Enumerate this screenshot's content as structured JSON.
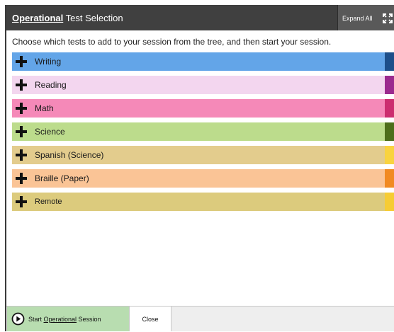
{
  "dialog": {
    "title_emphasis": "Operational",
    "title_rest": " Test Selection",
    "expand_all_label": "Expand All",
    "instructions": "Choose which tests to add to your session from the tree, and then start your session."
  },
  "tests": [
    {
      "label": "Writing",
      "bg": "#63a5e8",
      "stripe": "#1d4f8a"
    },
    {
      "label": "Reading",
      "bg": "#f3d6ef",
      "stripe": "#9b2a8e"
    },
    {
      "label": "Math",
      "bg": "#f589b8",
      "stripe": "#cc2e6f"
    },
    {
      "label": "Science",
      "bg": "#bcdc8c",
      "stripe": "#4d6e1b"
    },
    {
      "label": "Spanish (Science)",
      "bg": "#e3cc8d",
      "stripe": "#f9d33f"
    },
    {
      "label": "Braille (Paper)",
      "bg": "#fac496",
      "stripe": "#f18a22"
    },
    {
      "label": "Remote",
      "bg": "#dccb7d",
      "stripe": "#f6cc34"
    }
  ],
  "footer": {
    "start_prefix": "Start ",
    "start_emphasis": "Operational",
    "start_suffix": " Session",
    "close_label": "Close"
  },
  "icons": {
    "expand": "expand-all-icon",
    "plus": "plus-icon",
    "play": "play-circle-icon"
  }
}
